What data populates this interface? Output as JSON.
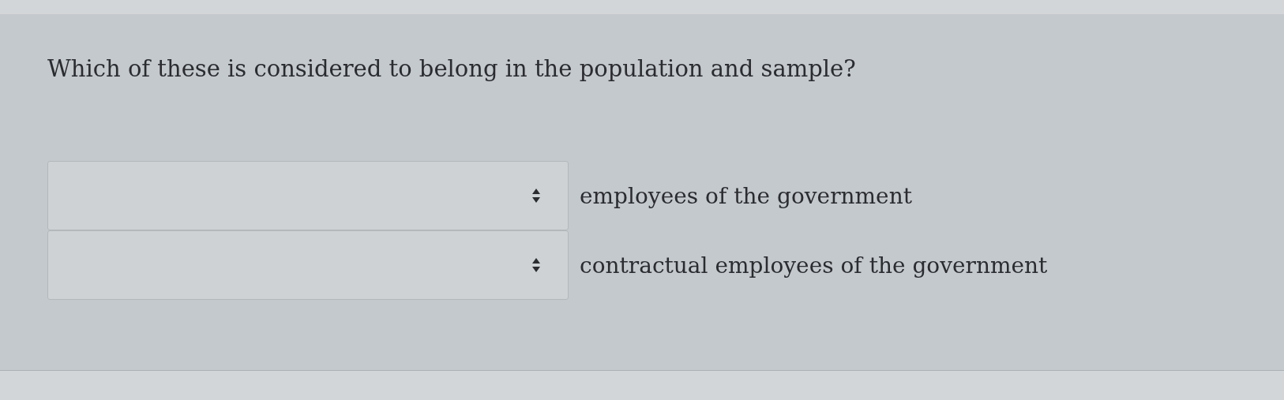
{
  "question": "Which of these is considered to belong in the population and sample?",
  "matches": [
    {
      "label": "employees of the government"
    },
    {
      "label": "contractual employees of the government"
    }
  ]
}
